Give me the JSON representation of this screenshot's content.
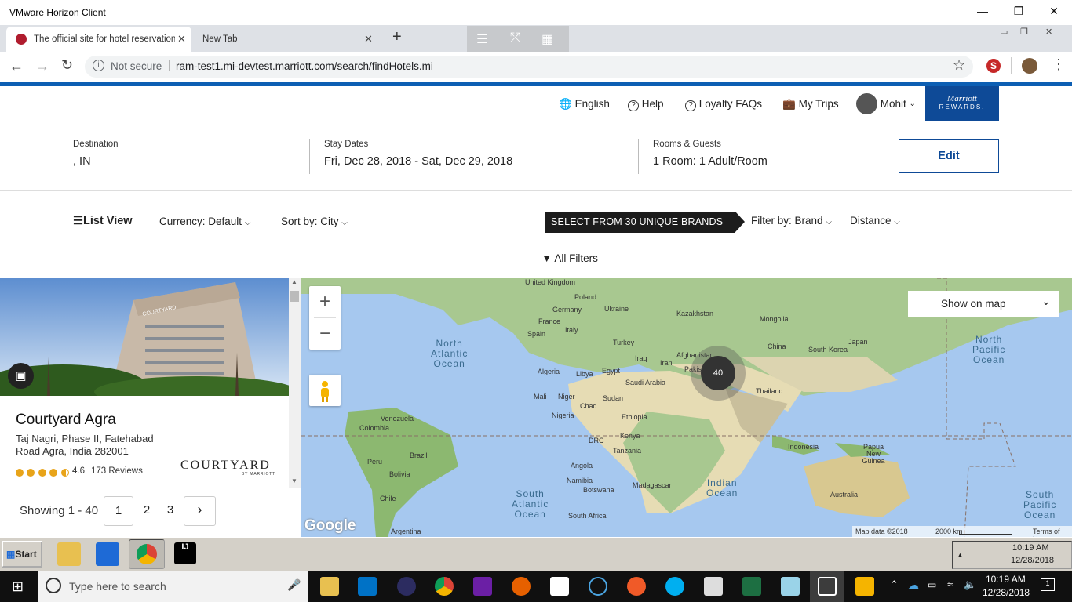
{
  "vmware": {
    "title": "VMware Horizon Client"
  },
  "browser": {
    "tabs": [
      {
        "label": "The official site for hotel reservation"
      },
      {
        "label": "New Tab"
      }
    ],
    "security": "Not secure",
    "url": "ram-test1.mi-devtest.marriott.com/search/findHotels.mi"
  },
  "header": {
    "links": [
      "English",
      "Help",
      "Loyalty FAQs",
      "My Trips"
    ],
    "user": "Mohit",
    "rewards_logo": {
      "brand": "Marriott",
      "sub": "REWARDS."
    }
  },
  "summary": {
    "destination": {
      "label": "Destination",
      "value": ", IN"
    },
    "dates": {
      "label": "Stay Dates",
      "value": "Fri, Dec 28, 2018 - Sat, Dec 29, 2018"
    },
    "rooms": {
      "label": "Rooms & Guests",
      "value": "1 Room: 1 Adult/Room"
    },
    "edit": "Edit"
  },
  "controls": {
    "list_view": "List View",
    "currency": "Currency: Default",
    "sort": "Sort by: City",
    "brands_banner": "SELECT FROM 30 UNIQUE BRANDS",
    "filter_brand": "Filter by: Brand",
    "distance": "Distance",
    "all_filters": "All Filters"
  },
  "hotel": {
    "name": "Courtyard Agra",
    "address_line1": "Taj Nagri, Phase II, Fatehabad",
    "address_line2": "Road Agra, India 282001",
    "rating": "4.6",
    "rating_value": 4.6,
    "reviews": "173 Reviews",
    "brand_logo": "COURTYARD",
    "brand_sub": "BY MARRIOTT",
    "image_sign": "COURTYARD"
  },
  "pager": {
    "showing": "Showing 1 - 40",
    "pages": [
      "1",
      "2",
      "3"
    ]
  },
  "map": {
    "show_on_map": "Show on map",
    "cluster": "40",
    "attribution": "Map data ©2018",
    "scale": "2000 km",
    "terms": "Terms of Use",
    "google": "Google",
    "ocean_labels": {
      "north_atlantic": "North\nAtlantic\nOcean",
      "south_atlantic": "South\nAtlantic\nOcean",
      "indian": "Indian\nOcean",
      "north_pacific": "North\nPacific\nOcean",
      "south_pacific": "South\nPacific\nOcean"
    },
    "places": [
      "United Kingdom",
      "Poland",
      "Germany",
      "Ukraine",
      "France",
      "Italy",
      "Spain",
      "Kazakhstan",
      "Mongolia",
      "Turkey",
      "Afghanistan",
      "Iraq",
      "Iran",
      "Pakistan",
      "China",
      "South Korea",
      "Japan",
      "Algeria",
      "Libya",
      "Egypt",
      "Saudi Arabia",
      "Thailand",
      "Mali",
      "Niger",
      "Chad",
      "Sudan",
      "Nigeria",
      "Ethiopia",
      "Venezuela",
      "Colombia",
      "Kenya",
      "Indonesia",
      "Papua New Guinea",
      "DRC",
      "Tanzania",
      "Brazil",
      "Peru",
      "Angola",
      "Bolivia",
      "Namibia",
      "Botswana",
      "Madagascar",
      "Chile",
      "Australia",
      "South Africa",
      "Argentina"
    ]
  },
  "vm_taskbar": {
    "start": "Start",
    "clock_time": "10:19 AM",
    "clock_date": "12/28/2018"
  },
  "win_taskbar": {
    "search_placeholder": "Type here to search",
    "clock_time": "10:19 AM",
    "clock_date": "12/28/2018",
    "notifications": "1"
  },
  "colors": {
    "brand_blue": "#0e4a97",
    "browser_blue": "#0d5fb3",
    "rating_gold": "#e8a41a"
  }
}
